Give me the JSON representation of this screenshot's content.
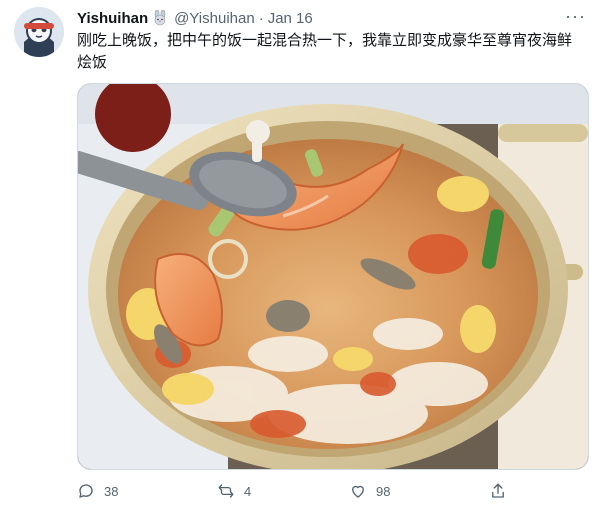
{
  "tweet": {
    "author_name": "Yishuihan",
    "author_emoji": "rabbit-face-icon",
    "handle": "@Yishuihan",
    "separator": "·",
    "date": "Jan 16",
    "text": "刚吃上晚饭，把中午的饭一起混合热一下，我靠立即变成豪华至尊宵夜海鲜烩饭",
    "image_subject": "seafood rice porridge in a metal pot with shrimp, egg, tomato and a spoon"
  },
  "actions": {
    "reply_count": "38",
    "retweet_count": "4",
    "like_count": "98"
  },
  "icons": {
    "more": "more-horizontal-icon",
    "reply": "reply-icon",
    "retweet": "retweet-icon",
    "like": "heart-icon",
    "share": "share-icon"
  },
  "colors": {
    "text_primary": "#0f1419",
    "text_secondary": "#536471",
    "border": "#cfd9de"
  }
}
